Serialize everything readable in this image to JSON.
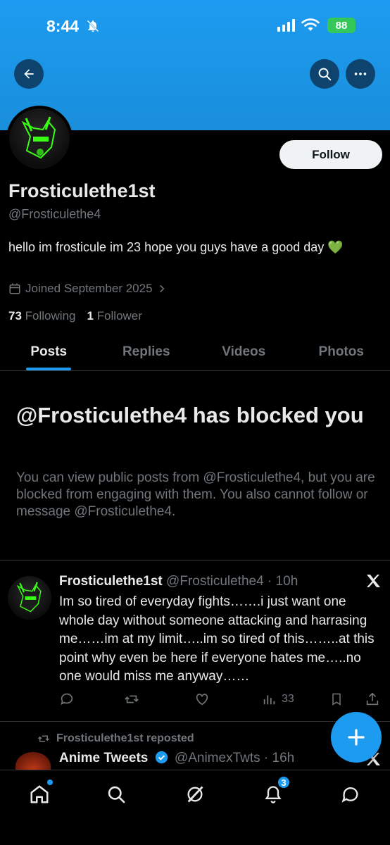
{
  "status_bar": {
    "time": "8:44",
    "battery": "88"
  },
  "profile": {
    "display_name": "Frosticulethe1st",
    "handle": "@Frosticulethe4",
    "bio": "hello im frosticule im 23 hope you guys have a good day 💚",
    "joined": "Joined September 2025",
    "following_count": "73",
    "following_label": "Following",
    "followers_count": "1",
    "followers_label": "Follower",
    "follow_button": "Follow"
  },
  "tabs": [
    "Posts",
    "Replies",
    "Videos",
    "Photos"
  ],
  "blocked": {
    "title": "@Frosticulethe4 has blocked you",
    "description": "You can view public posts from @Frosticulethe4, but you are blocked from engaging with them. You also cannot follow or message @Frosticulethe4."
  },
  "tweet": {
    "name": "Frosticulethe1st",
    "handle_time": "@Frosticulethe4 · 10h",
    "text": "Im so tired of everyday fights…….i just want one whole day without someone attacking and harrasing me……im at my limit…..im so tired of this……..at this point why even be here if everyone hates me…..no one would miss me anyway……",
    "views": "33"
  },
  "repost": {
    "label": "Frosticulethe1st reposted",
    "name": "Anime Tweets",
    "handle_time": "@AnimexTwts · 16h"
  },
  "nav": {
    "notifications_badge": "3"
  },
  "colors": {
    "accent": "#1d9bf0",
    "banner": "#1d9bf0",
    "muted": "#71767b"
  }
}
